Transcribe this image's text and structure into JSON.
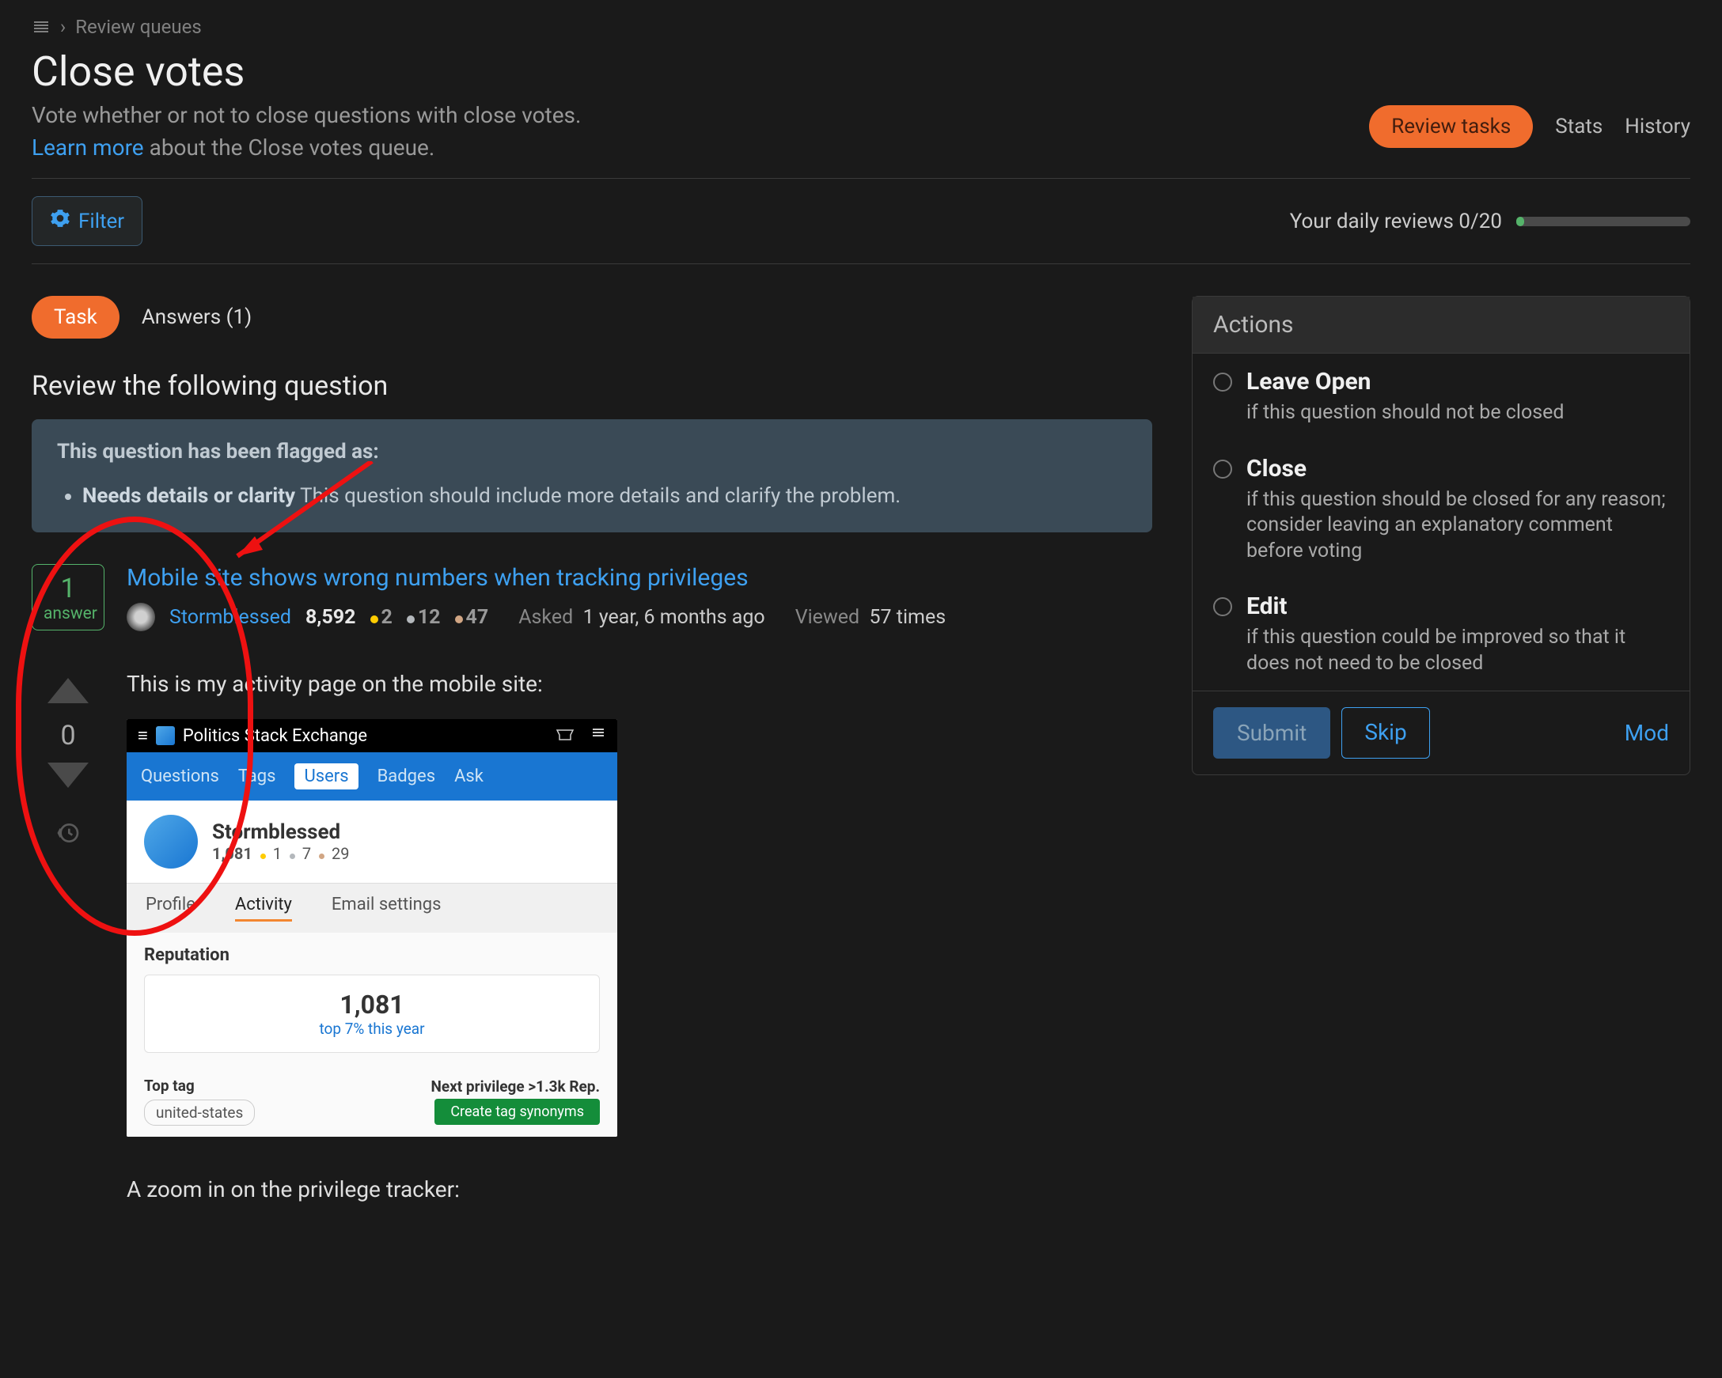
{
  "breadcrumb": {
    "label": "Review queues"
  },
  "page": {
    "title": "Close votes",
    "subtitle": "Vote whether or not to close questions with close votes.",
    "learn_more": "Learn more",
    "learn_more_suffix": " about the Close votes queue."
  },
  "top_tabs": {
    "review_tasks": "Review tasks",
    "stats": "Stats",
    "history": "History"
  },
  "filter": {
    "label": "Filter"
  },
  "daily_reviews": {
    "prefix": "Your daily reviews ",
    "count": "0",
    "sep": "/",
    "max": "20"
  },
  "inner_tabs": {
    "task": "Task",
    "answers": "Answers (1)"
  },
  "instruction": "Review the following question",
  "flag_box": {
    "title": "This question has been flagged as:",
    "reason_bold": "Needs details or clarity",
    "reason_text": " This question should include more details and clarify the problem."
  },
  "answer_badge": {
    "n": "1",
    "label": "answer"
  },
  "question": {
    "title": "Mobile site shows wrong numbers when tracking privileges",
    "author": "Stormblessed",
    "rep": "8,592",
    "gold": "2",
    "silver": "12",
    "bronze": "47",
    "asked_label": "Asked",
    "asked_value": "1 year, 6 months ago",
    "viewed_label": "Viewed",
    "viewed_value": "57 times"
  },
  "vote": {
    "count": "0"
  },
  "body": {
    "p1": "This is my activity page on the mobile site:",
    "p2": "A zoom in on the privilege tracker:"
  },
  "screenshot": {
    "site_name": "Politics Stack Exchange",
    "nav": {
      "questions": "Questions",
      "tags": "Tags",
      "users": "Users",
      "badges": "Badges",
      "ask": "Ask"
    },
    "profile_name": "Stormblessed",
    "profile_rep": "1,081",
    "profile_g": "1",
    "profile_s": "7",
    "profile_b": "29",
    "tabs": {
      "profile": "Profile",
      "activity": "Activity",
      "email": "Email settings"
    },
    "rep_label": "Reputation",
    "big_num": "1,081",
    "top_line": "top 7% this year",
    "top_tag_label": "Top tag",
    "tag": "united-states",
    "priv_label": "Next privilege >1.3k Rep.",
    "priv_btn": "Create tag synonyms"
  },
  "actions": {
    "header": "Actions",
    "items": [
      {
        "title": "Leave Open",
        "desc": "if this question should not be closed"
      },
      {
        "title": "Close",
        "desc": "if this question should be closed for any reason; consider leaving an explanatory comment before voting"
      },
      {
        "title": "Edit",
        "desc": "if this question could be improved so that it does not need to be closed"
      }
    ],
    "submit": "Submit",
    "skip": "Skip",
    "mod": "Mod"
  }
}
